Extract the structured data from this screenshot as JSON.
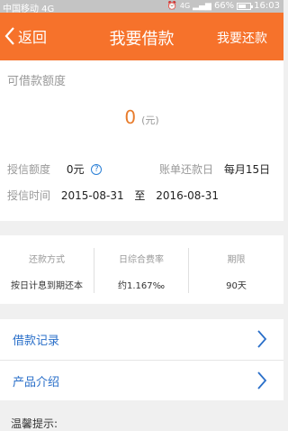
{
  "status_bar": {
    "carrier": "中国移动 4G",
    "network": "4G",
    "battery": "66%",
    "battery_level": 0.66,
    "time": "16:03"
  },
  "header": {
    "back_label": "返回",
    "title": "我要借款",
    "right_action": "我要还款",
    "color": "#f6722b"
  },
  "limit": {
    "label": "可借款额度",
    "amount": "0",
    "unit": "(元)",
    "credit_label": "授信额度",
    "credit_value": "0元",
    "due_label": "账单还款日",
    "due_value": "每月15日",
    "period_label": "授信时间",
    "period_start": "2015-08-31",
    "period_sep": "至",
    "period_end": "2016-08-31"
  },
  "terms": [
    {
      "label": "还款方式",
      "value": "按日计息到期还本"
    },
    {
      "label": "日综合费率",
      "value": "约1.167‰"
    },
    {
      "label": "期限",
      "value": "90天"
    }
  ],
  "menu": {
    "items": [
      {
        "label": "借款记录"
      },
      {
        "label": "产品介绍"
      }
    ]
  },
  "tips": {
    "label": "温馨提示:"
  },
  "colors": {
    "accent": "#f6722b",
    "amount": "#e87c2c",
    "link": "#2a6fc9"
  }
}
